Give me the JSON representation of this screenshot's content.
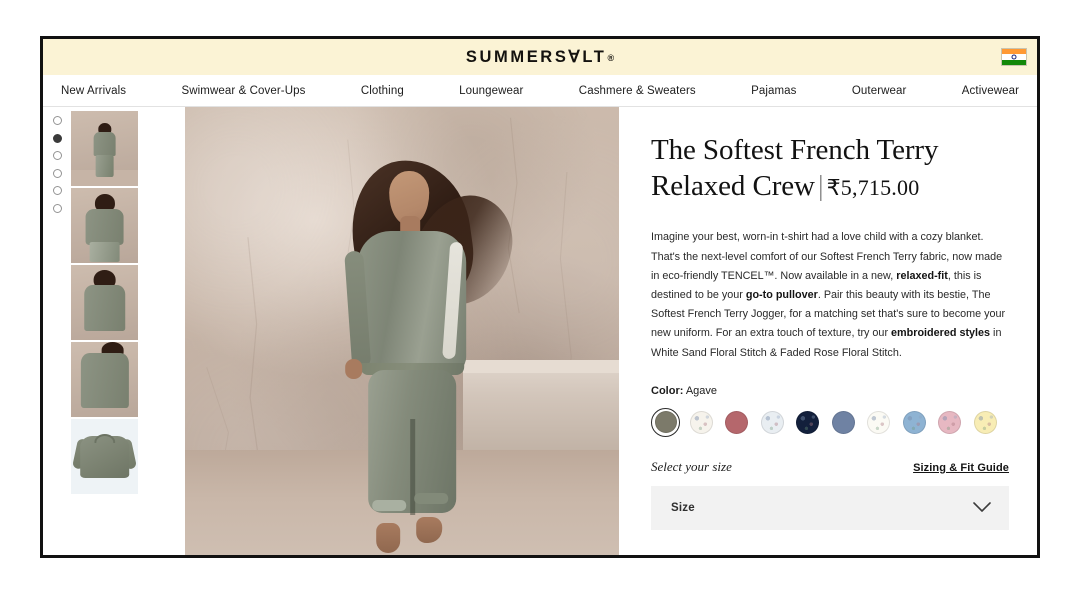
{
  "banner": {
    "logo_text": "SUMMERS∀LT",
    "logo_dot": "®",
    "flag_name": "india-flag",
    "bg_color": "#fbf3d5"
  },
  "nav": {
    "items": [
      {
        "label": "New Arrivals"
      },
      {
        "label": "Swimwear & Cover-Ups"
      },
      {
        "label": "Clothing"
      },
      {
        "label": "Loungewear"
      },
      {
        "label": "Cashmere & Sweaters"
      },
      {
        "label": "Pajamas"
      },
      {
        "label": "Outerwear"
      },
      {
        "label": "Activewear"
      }
    ]
  },
  "gallery": {
    "dots": [
      {
        "active": false
      },
      {
        "active": true
      },
      {
        "active": false
      },
      {
        "active": false
      },
      {
        "active": false
      },
      {
        "active": false
      }
    ],
    "thumbnails": [
      {
        "alt": "model full length front",
        "selected": true,
        "kind": "model-full"
      },
      {
        "alt": "model front torso",
        "selected": false,
        "kind": "model-front"
      },
      {
        "alt": "model back view",
        "selected": false,
        "kind": "model-back"
      },
      {
        "alt": "model sleeve detail",
        "selected": false,
        "kind": "model-detail"
      },
      {
        "alt": "flat lay sweatshirt",
        "selected": false,
        "kind": "flat-lay"
      }
    ],
    "hero_alt": "model wearing sage french terry crew and joggers against concrete wall"
  },
  "product": {
    "title": "The Softest French Terry Relaxed Crew",
    "title_divider": "|",
    "price": "₹5,715.00",
    "description_parts": [
      {
        "text": "Imagine your best, worn-in t-shirt had a love child with a cozy blanket. That's the next-level comfort of our Softest French Terry fabric, now made in eco-friendly TENCEL™. Now available in a new, ",
        "bold": false
      },
      {
        "text": "relaxed-fit",
        "bold": true
      },
      {
        "text": ", this is destined to be your ",
        "bold": false
      },
      {
        "text": "go-to pullover",
        "bold": true
      },
      {
        "text": ". Pair this beauty with its bestie, The Softest French Terry Jogger, for a matching set that's sure to become your new uniform. For an extra touch of texture, try our ",
        "bold": false
      },
      {
        "text": "embroidered styles",
        "bold": true
      },
      {
        "text": " in White Sand Floral Stitch & Faded Rose Floral Stitch.",
        "bold": false
      }
    ],
    "color_lead": "Color:",
    "color_value": "Agave",
    "swatches": [
      {
        "name": "Agave",
        "color": "#7c7a6a",
        "selected": true
      },
      {
        "name": "White Sand Floral Stitch",
        "color": "#f6f3ec",
        "selected": false
      },
      {
        "name": "Faded Rose",
        "color": "#b5676c",
        "selected": false
      },
      {
        "name": "Light Floral Print",
        "color": "#e9eef2",
        "selected": false
      },
      {
        "name": "Navy Floral Print",
        "color": "#13203c",
        "selected": false
      },
      {
        "name": "Slate Blue",
        "color": "#6f82a3",
        "selected": false
      },
      {
        "name": "Cream",
        "color": "#fbfaf4",
        "selected": false
      },
      {
        "name": "Blue Tie Dye",
        "color": "#8eb3d3",
        "selected": false
      },
      {
        "name": "Pink Floral",
        "color": "#e7b8c2",
        "selected": false
      },
      {
        "name": "Pale Yellow",
        "color": "#f8edb5",
        "selected": false
      }
    ],
    "size_prompt": "Select your size",
    "sizing_guide_label": "Sizing & Fit Guide",
    "size_placeholder": "Size",
    "size_chevron_icon": "chevron-down-icon"
  }
}
